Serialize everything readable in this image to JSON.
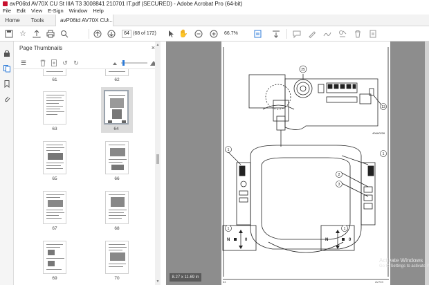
{
  "window": {
    "title": "avP06td AV70X CU St IIIA T3 3008841 210701 IT.pdf (SECURED) - Adobe Acrobat Pro (64-bit)"
  },
  "menu": [
    "File",
    "Edit",
    "View",
    "E-Sign",
    "Window",
    "Help"
  ],
  "tabs": {
    "home": "Home",
    "tools": "Tools",
    "document": "avP06td AV70X CU...",
    "close": "×"
  },
  "toolbar": {
    "page_number": "64",
    "page_of": "(68 of 172)",
    "zoom": "66.7%"
  },
  "thumbnails_panel": {
    "title": "Page Thumbnails",
    "close": "×",
    "labels": [
      "61",
      "62",
      "63",
      "64",
      "65",
      "66",
      "67",
      "68",
      "69",
      "70"
    ],
    "selected": "64",
    "zoom_level_fraction": 0.05
  },
  "document": {
    "size_badge": "8.27 x 11.69 in",
    "figure_code": "406A0226",
    "callouts": [
      "25",
      "13",
      "1",
      "1",
      "2",
      "3",
      "1",
      "1"
    ],
    "neutral_label": "N",
    "zero_label": "0",
    "footer_left": "64",
    "footer_right": "AV70X"
  },
  "overlay": {
    "activate_title": "Activate Windows",
    "activate_sub": "Go to Settings to activate Windows."
  },
  "colors": {
    "selected_thumb_border": "#9aa3ad",
    "accent_blue": "#2d7bd8",
    "doc_background": "#8d8d8d"
  }
}
